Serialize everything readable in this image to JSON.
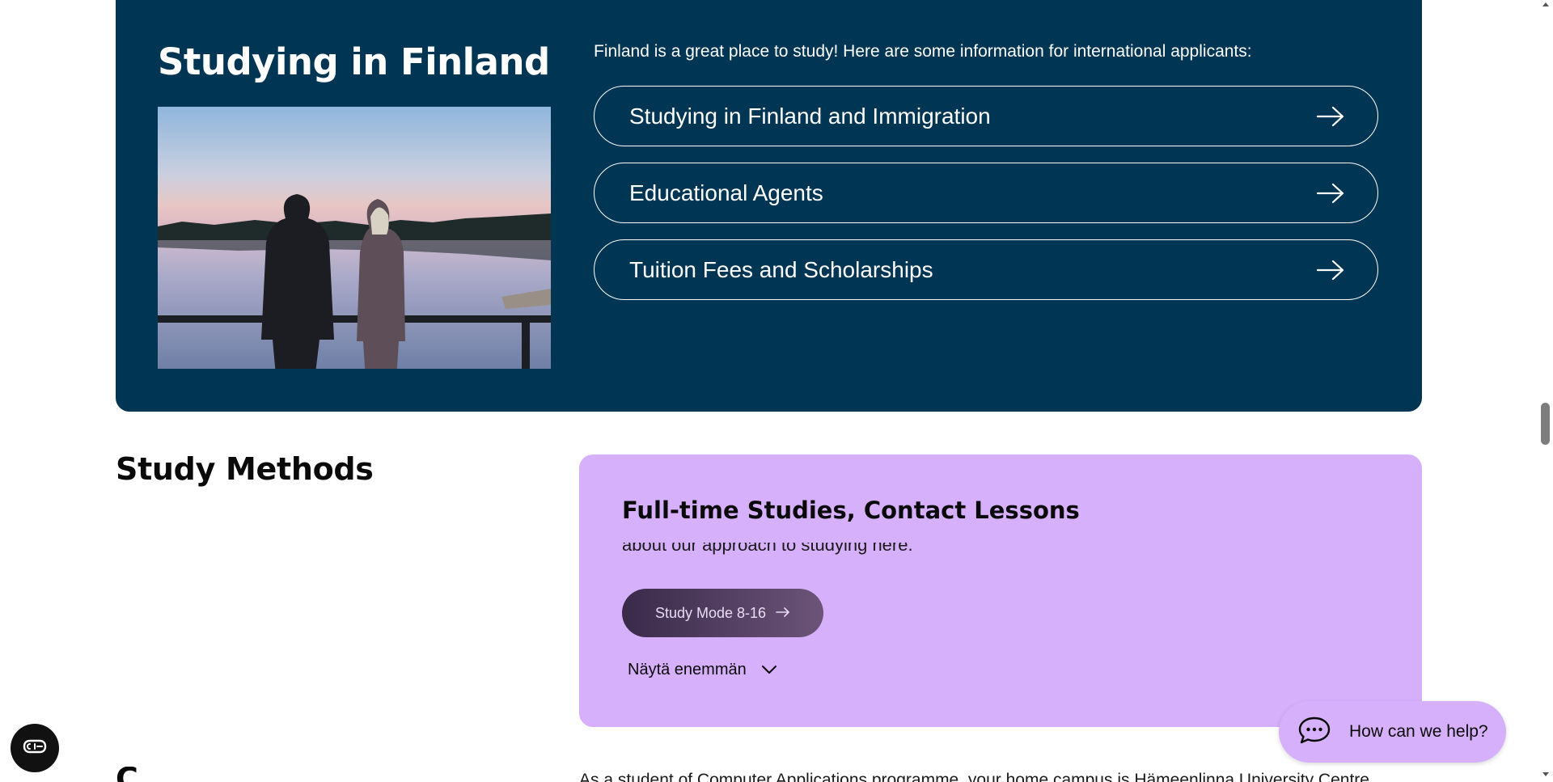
{
  "studying_in_finland": {
    "title": "Studying in Finland",
    "intro": "Finland is a great place to study! Here are some information for international applicants:",
    "links": [
      {
        "label": "Studying in Finland and Immigration",
        "icon": "arrow-right-icon"
      },
      {
        "label": "Educational Agents",
        "icon": "arrow-right-icon"
      },
      {
        "label": "Tuition Fees and Scholarships",
        "icon": "arrow-right-icon"
      }
    ],
    "background_color": "#003554"
  },
  "study_methods": {
    "heading": "Study Methods",
    "card": {
      "title": "Full-time Studies, Contact Lessons",
      "partial_text": "about our approach to studying here.",
      "button_label": "Study Mode 8-16",
      "show_more_label": "Näytä enemmän",
      "background_color": "#d6b0fb"
    }
  },
  "campus": {
    "heading_partial": "C",
    "text_partial": "As a student of Computer Applications programme, your home campus is Hämeenlinna University Centre."
  },
  "chat": {
    "label": "How can we help?",
    "icon": "chat-bubble-icon"
  },
  "accessibility": {
    "icon": "accessibility-icon"
  }
}
